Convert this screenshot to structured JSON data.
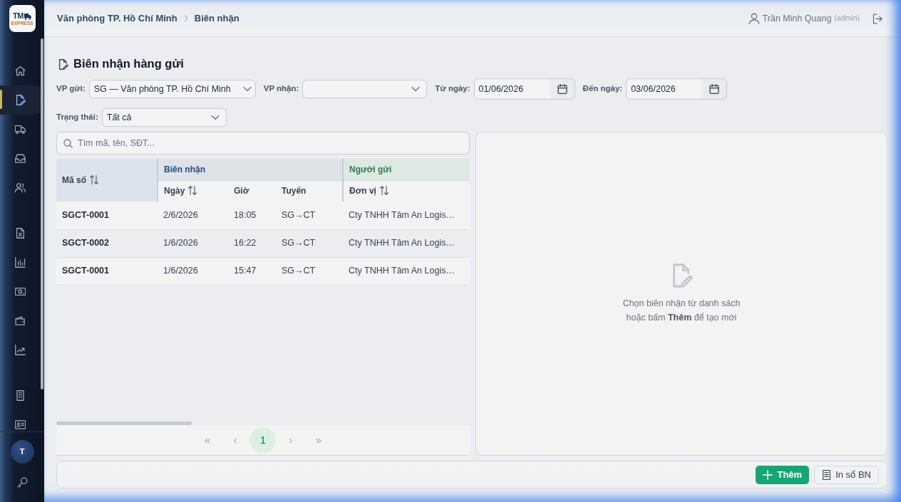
{
  "sidebar": {
    "logo": {
      "text": "TM",
      "subtext": "EXPRESS"
    },
    "nav_groups": [
      {
        "items": [
          {
            "selected": false
          },
          {
            "selected": true
          },
          {
            "selected": false
          },
          {
            "selected": false
          },
          {
            "selected": false
          }
        ]
      },
      {
        "items": [
          {
            "selected": false
          },
          {
            "selected": false
          },
          {
            "selected": false
          },
          {
            "selected": false
          },
          {
            "selected": false
          }
        ]
      },
      {
        "items": [
          {
            "selected": false
          },
          {
            "selected": false
          }
        ]
      }
    ],
    "avatar": {
      "initial": "T"
    }
  },
  "breadcrumb": [
    {
      "label": "Văn phòng TP. Hồ Chí Minh"
    },
    {
      "label": "Biên nhận"
    }
  ],
  "user": {
    "name": "Trần Minh Quang",
    "role": "(admin)"
  },
  "page_title": "Biên nhận hàng gửi",
  "filter_rows": [
    {
      "fields": [
        {
          "kind": "select",
          "label": "VP gửi:",
          "value": "SG — Văn phòng TP. Hồ Chí Minh"
        },
        {
          "kind": "select",
          "label": "VP nhận:"
        },
        {
          "kind": "date",
          "label": "Từ ngày:",
          "value": "01/06/2026"
        },
        {
          "kind": "date",
          "label": "Đến ngày:",
          "value": "03/06/2026"
        }
      ]
    },
    {
      "fields": [
        {
          "kind": "select",
          "label": "Trạng thái:",
          "value": "Tất cả"
        }
      ]
    }
  ],
  "search": {
    "placeholder": "Tìm mã, tên, SĐT..."
  },
  "table": {
    "key_column": {
      "label": "Mã số",
      "sortable": true
    },
    "column_groups": [
      {
        "label": "Biên nhận",
        "color": "#2c4a7a",
        "columns": [
          {
            "label": "Ngày",
            "sortable": true
          },
          {
            "label": "Giờ",
            "sortable": false
          },
          {
            "label": "Tuyến",
            "sortable": false
          }
        ]
      },
      {
        "label": "Người gửi",
        "color": "#2e7d4a",
        "columns": [
          {
            "label": "Đơn vị",
            "sortable": true
          }
        ]
      }
    ],
    "rows": [
      {
        "selected": false,
        "cells": [
          "SGCT-0001",
          "2/6/2026",
          "18:05",
          "SG→CT",
          "Cty TNHH Tâm An Logis…"
        ]
      },
      {
        "selected": false,
        "cells": [
          "SGCT-0002",
          "1/6/2026",
          "16:22",
          "SG→CT",
          "Cty TNHH Tâm An Logis…"
        ]
      },
      {
        "selected": false,
        "cells": [
          "SGCT-0001",
          "1/6/2026",
          "15:47",
          "SG→CT",
          "Cty TNHH Tâm An Logis…"
        ]
      }
    ]
  },
  "pagination": {
    "first": "«",
    "prev": "‹",
    "pages": [
      {
        "label": "1",
        "selected": true
      }
    ],
    "next": "›",
    "last": "»"
  },
  "detail_panel": {
    "empty_state": {
      "lines": [
        "Chọn biên nhận từ danh sách",
        "hoặc bấm **Thêm** để tạo mới"
      ]
    }
  },
  "actions": [
    {
      "kind": "primary",
      "label": "Thêm"
    },
    {
      "kind": "outline",
      "label": "In sổ BN"
    }
  ]
}
